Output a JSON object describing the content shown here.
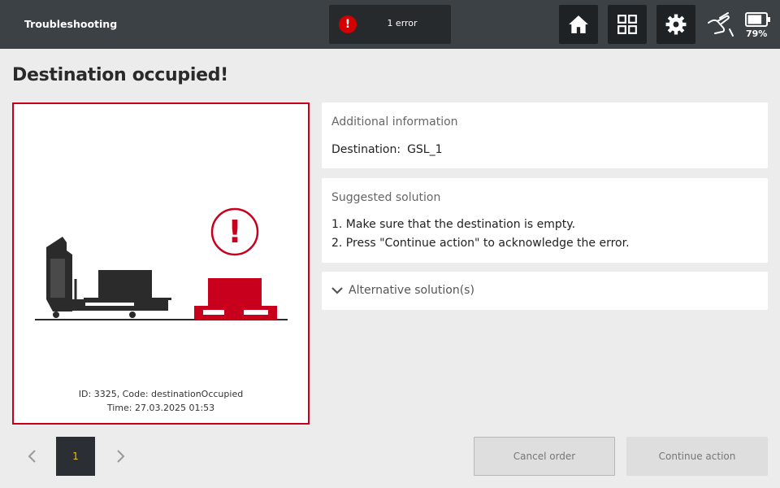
{
  "topbar": {
    "title": "Troubleshooting",
    "error_icon_glyph": "!",
    "error_count_label": "1 error",
    "battery_percent": "79%",
    "icons": [
      "error-icon",
      "home-icon",
      "grid-icon",
      "gear-icon",
      "hand-touch-icon",
      "battery-icon"
    ],
    "battery_level": 0.79
  },
  "page": {
    "title": "Destination occupied!"
  },
  "illustration": {
    "meta_id": "ID: 3325, Code: destinationOccupied",
    "meta_time": "Time: 27.03.2025 01:53",
    "alert_glyph": "!"
  },
  "additional_info": {
    "heading": "Additional information",
    "destination_label": "Destination:",
    "destination_value": "GSL_1"
  },
  "suggested_solution": {
    "heading": "Suggested solution",
    "steps": [
      "1. Make sure that the destination is empty.",
      "2. Press \"Continue action\" to acknowledge the error."
    ]
  },
  "alternative": {
    "label": "Alternative solution(s)"
  },
  "pager": {
    "current_page": "1"
  },
  "footer": {
    "cancel_label": "Cancel order",
    "continue_label": "Continue action"
  },
  "colors": {
    "topbar": "#3c4146",
    "accent_red": "#c8001e",
    "page_number": "#f0c000",
    "background": "#ececec"
  }
}
